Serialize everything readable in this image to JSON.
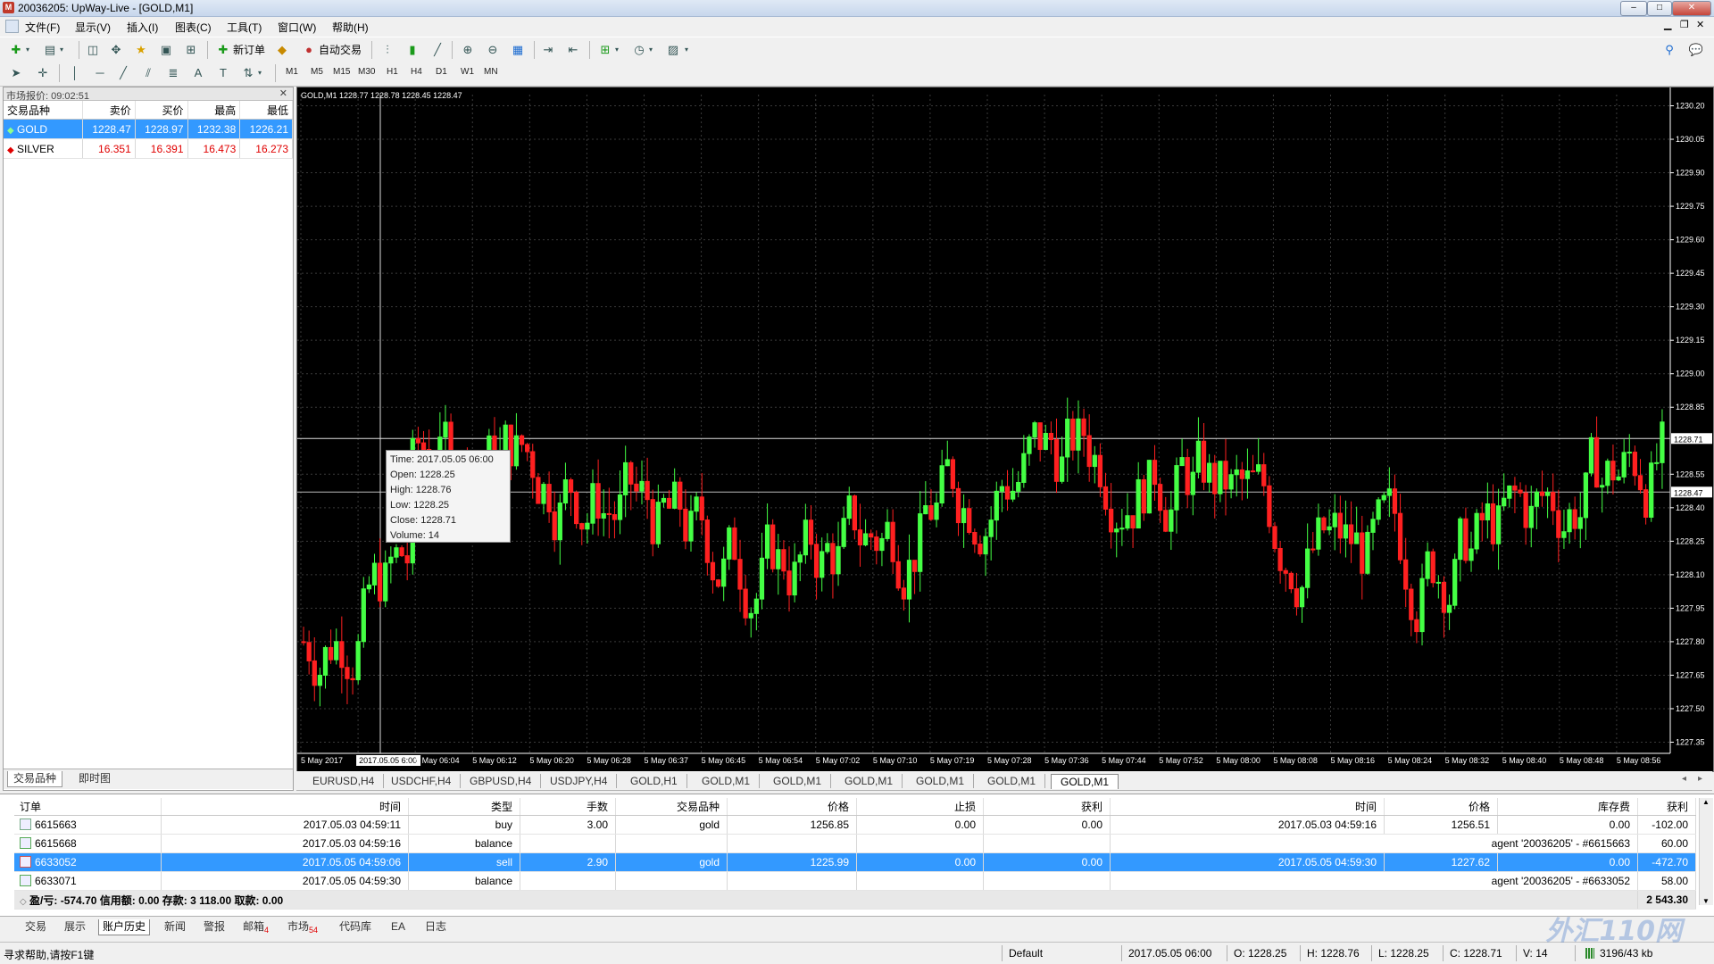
{
  "window": {
    "title": "20036205: UpWay-Live - [GOLD,M1]"
  },
  "menu": [
    "文件(F)",
    "显示(V)",
    "插入(I)",
    "图表(C)",
    "工具(T)",
    "窗口(W)",
    "帮助(H)"
  ],
  "toolbar": {
    "new_order": "新订单",
    "auto_trading": "自动交易",
    "timeframes": [
      "M1",
      "M5",
      "M15",
      "M30",
      "H1",
      "H4",
      "D1",
      "W1",
      "MN"
    ]
  },
  "market_watch": {
    "title": "市场报价: 09:02:51",
    "headers": [
      "交易品种",
      "卖价",
      "买价",
      "最高",
      "最低"
    ],
    "rows": [
      {
        "symbol": "GOLD",
        "bid": "1228.47",
        "ask": "1228.97",
        "high": "1232.38",
        "low": "1226.21"
      },
      {
        "symbol": "SILVER",
        "bid": "16.351",
        "ask": "16.391",
        "high": "16.473",
        "low": "16.273"
      }
    ],
    "tabs": [
      "交易品种",
      "即时图"
    ]
  },
  "chart": {
    "header": "GOLD,M1  1228.77 1228.78 1228.45 1228.47",
    "y_min": 1227.3,
    "y_max": 1230.25,
    "y_ticks": [
      "1230.20",
      "1230.05",
      "1229.90",
      "1229.75",
      "1229.60",
      "1229.45",
      "1229.30",
      "1229.15",
      "1229.00",
      "1228.85",
      "1228.71",
      "1228.55",
      "1228.47",
      "1228.40",
      "1228.25",
      "1228.10",
      "1227.95",
      "1227.80",
      "1227.65",
      "1227.50",
      "1227.35"
    ],
    "crosshair_price": "1228.71",
    "bid_price": "1228.47",
    "x_ticks": [
      "5 May 2017",
      "2017.05.05 6:00",
      "5 May 06:04",
      "5 May 06:12",
      "5 May 06:20",
      "5 May 06:28",
      "5 May 06:37",
      "5 May 06:45",
      "5 May 06:54",
      "5 May 07:02",
      "5 May 07:10",
      "5 May 07:19",
      "5 May 07:28",
      "5 May 07:36",
      "5 May 07:44",
      "5 May 07:52",
      "5 May 08:00",
      "5 May 08:08",
      "5 May 08:16",
      "5 May 08:24",
      "5 May 08:32",
      "5 May 08:40",
      "5 May 08:48",
      "5 May 08:56"
    ],
    "tooltip": {
      "time": "Time: 2017.05.05 06:00",
      "open": "Open: 1228.25",
      "high": "High: 1228.76",
      "low": "Low:  1228.25",
      "close": "Close: 1228.71",
      "volume": "Volume: 14"
    },
    "colors": {
      "up": "#44ff44",
      "down": "#ff2020",
      "grid": "#3a3a3a",
      "background": "#000000"
    }
  },
  "chart_tabs": [
    "EURUSD,H4",
    "USDCHF,H4",
    "GBPUSD,H4",
    "USDJPY,H4",
    "GOLD,H1",
    "GOLD,M1",
    "GOLD,M1",
    "GOLD,M1",
    "GOLD,M1",
    "GOLD,M1",
    "GOLD,M1"
  ],
  "terminal": {
    "headers": [
      "订单",
      "时间",
      "类型",
      "手数",
      "交易品种",
      "价格",
      "止损",
      "获利",
      "时间",
      "价格",
      "库存费",
      "获利"
    ],
    "rows": [
      [
        "6615663",
        "2017.05.03 04:59:11",
        "buy",
        "3.00",
        "gold",
        "1256.85",
        "0.00",
        "0.00",
        "2017.05.03 04:59:16",
        "1256.51",
        "0.00",
        "-102.00"
      ],
      [
        "6615668",
        "2017.05.03 04:59:16",
        "balance",
        "",
        "",
        "",
        "",
        "",
        "",
        "agent '20036205' - #6615663",
        "",
        "60.00"
      ],
      [
        "6633052",
        "2017.05.05 04:59:06",
        "sell",
        "2.90",
        "gold",
        "1225.99",
        "0.00",
        "0.00",
        "2017.05.05 04:59:30",
        "1227.62",
        "0.00",
        "-472.70"
      ],
      [
        "6633071",
        "2017.05.05 04:59:30",
        "balance",
        "",
        "",
        "",
        "",
        "",
        "",
        "agent '20036205' - #6633052",
        "",
        "58.00"
      ]
    ],
    "summary": "盈/亏: -574.70  信用额: 0.00  存款: 3 118.00  取款: 0.00",
    "summary_total": "2 543.30",
    "tabs": [
      "交易",
      "展示",
      "账户历史",
      "新闻",
      "警报",
      "邮箱",
      "市场",
      "代码库",
      "EA",
      "日志"
    ],
    "mail_count": "4",
    "market_count": "54"
  },
  "status": {
    "help": "寻求帮助,请按F1键",
    "profile": "Default",
    "time": "2017.05.05 06:00",
    "open": "O: 1228.25",
    "high": "H: 1228.76",
    "low": "L: 1228.25",
    "close": "C: 1228.71",
    "volume": "V: 14",
    "traffic": "3196/43 kb"
  },
  "watermark": "外汇110网"
}
